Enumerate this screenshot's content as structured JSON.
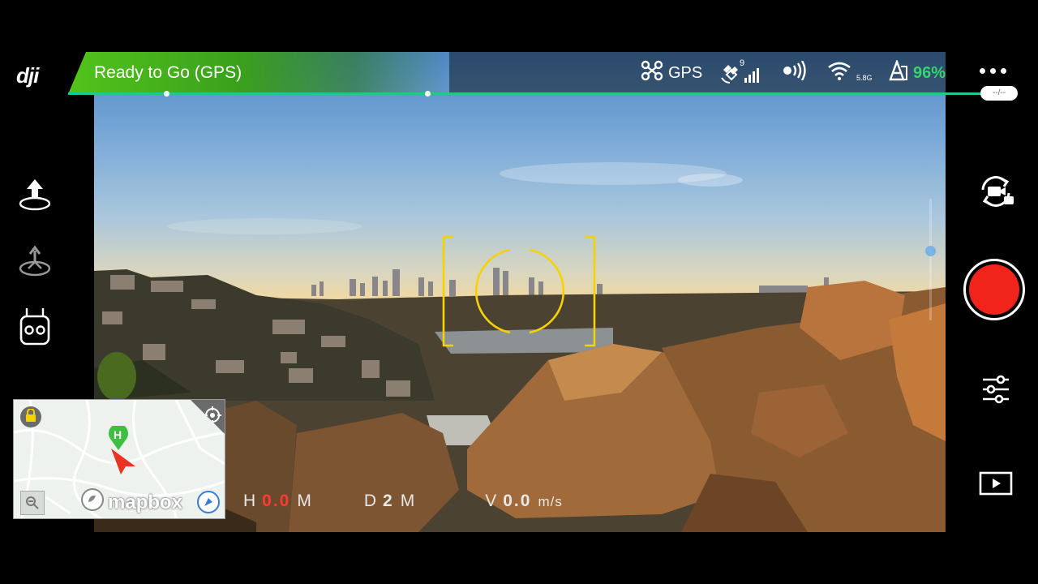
{
  "app": {
    "brand": "dji"
  },
  "status": {
    "text": "Ready to Go (GPS)",
    "color": "#52c41a"
  },
  "topbar": {
    "flight_mode": "GPS",
    "satellite_count": "9",
    "wifi_band": "5.8G",
    "battery_percent": "96%",
    "progress_marker": "--/--"
  },
  "telemetry": {
    "height": {
      "label": "H",
      "value": "0.0",
      "unit": "M"
    },
    "distance": {
      "label": "D",
      "value": "2",
      "unit": "M"
    },
    "vspeed": {
      "label": "V",
      "value": "0.0",
      "unit": "m/s"
    }
  },
  "map": {
    "home_marker": "H",
    "attribution": "mapbox"
  },
  "colors": {
    "accent_green": "#1fc98a",
    "record_red": "#f0241a",
    "focus_yellow": "#f5d300",
    "battery_green": "#36d46e",
    "height_red": "#ff3b30"
  },
  "icons": {
    "left": [
      "takeoff-icon",
      "return-home-icon",
      "remote-controller-icon"
    ],
    "right": [
      "menu-icon",
      "switch-camera-icon",
      "record-icon",
      "settings-sliders-icon",
      "playback-icon"
    ],
    "topbar": [
      "drone-icon",
      "satellite-signal-icon",
      "rc-signal-icon",
      "wifi-icon",
      "battery-icon"
    ]
  }
}
